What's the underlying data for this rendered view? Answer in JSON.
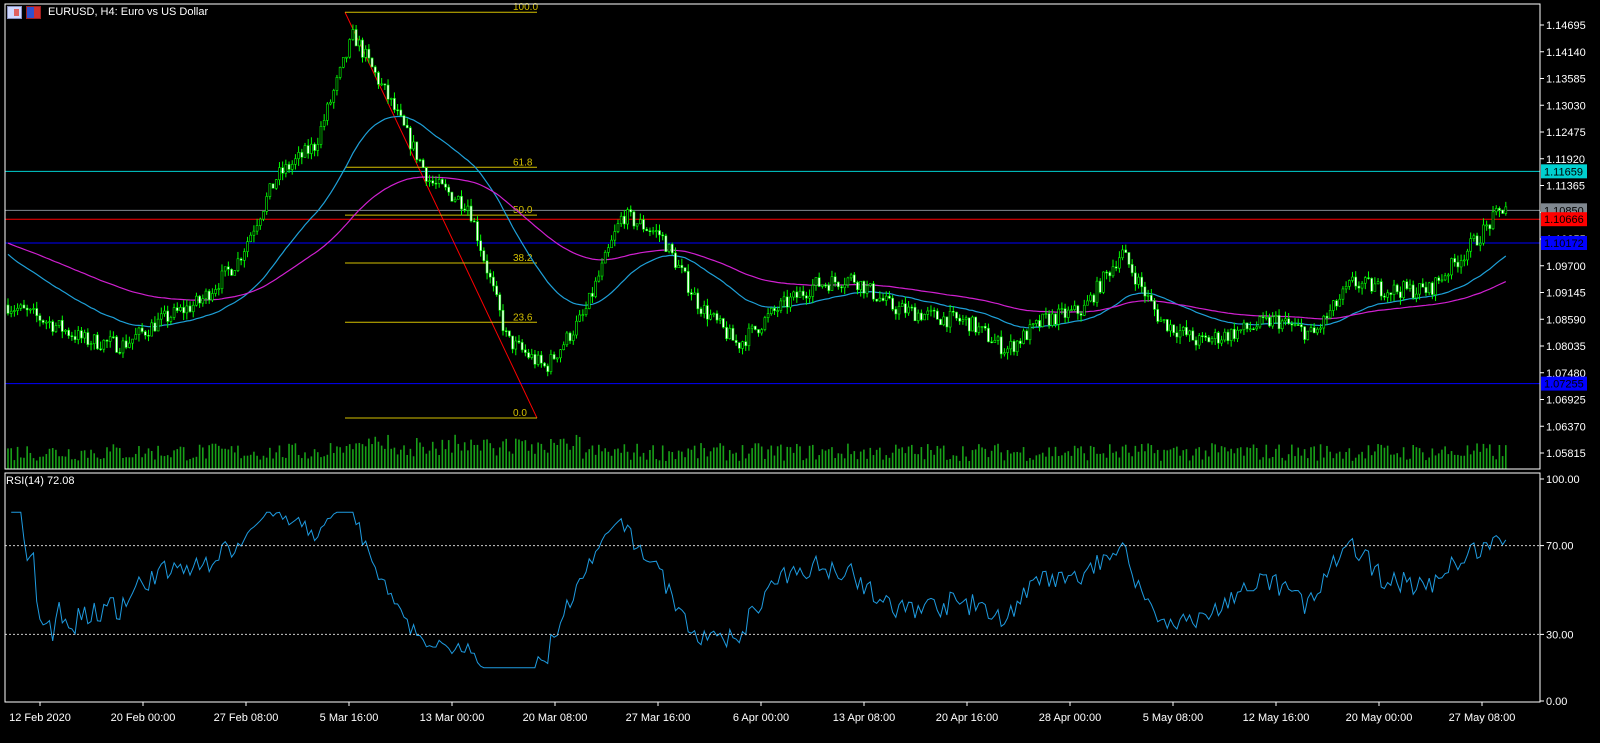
{
  "header": {
    "title": "EURUSD, H4:  Euro vs US Dollar",
    "icons": [
      "chart-window-icon",
      "save-icon"
    ]
  },
  "price_axis": {
    "ticks": [
      "1.14695",
      "1.14140",
      "1.13585",
      "1.13030",
      "1.12475",
      "1.11920",
      "1.11365",
      "1.10810",
      "1.10255",
      "1.09700",
      "1.09145",
      "1.08590",
      "1.08035",
      "1.07480",
      "1.06925",
      "1.06370",
      "1.05815"
    ]
  },
  "price_lines": [
    {
      "price": 1.11659,
      "label": "1.11659",
      "color": "#00d0d0",
      "text_color": "#000000"
    },
    {
      "price": 1.1085,
      "label": "1.10850",
      "color": "#808890",
      "text_color": "#000000"
    },
    {
      "price": 1.10666,
      "label": "1.10666",
      "color": "#ff0000",
      "text_color": "#000000"
    },
    {
      "price": 1.10172,
      "label": "1.10172",
      "color": "#0000ff",
      "text_color": "#000000"
    },
    {
      "price": 1.07255,
      "label": "1.07255",
      "color": "#0000ff",
      "text_color": "#000000"
    }
  ],
  "fibonacci": {
    "high": 1.1496,
    "low": 1.0654,
    "color": "#d4c000",
    "trend_color": "#ff0000",
    "levels": [
      {
        "value": 100.0,
        "label": "100.0"
      },
      {
        "value": 61.8,
        "label": "61.8"
      },
      {
        "value": 50.0,
        "label": "50.0"
      },
      {
        "value": 38.2,
        "label": "38.2"
      },
      {
        "value": 23.6,
        "label": "23.6"
      },
      {
        "value": 0.0,
        "label": "0.0"
      }
    ]
  },
  "time_axis": {
    "ticks": [
      "12 Feb 2020",
      "20 Feb 00:00",
      "27 Feb 08:00",
      "5 Mar 16:00",
      "13 Mar 00:00",
      "20 Mar 08:00",
      "27 Mar 16:00",
      "6 Apr 00:00",
      "13 Apr 08:00",
      "20 Apr 16:00",
      "28 Apr 00:00",
      "5 May 08:00",
      "12 May 16:00",
      "20 May 00:00",
      "27 May 08:00"
    ]
  },
  "rsi": {
    "title": "RSI(14) 72.08",
    "ticks": [
      "100.00",
      "70.00",
      "30.00",
      "0.00"
    ],
    "levels": [
      70,
      30
    ],
    "color": "#1e9be0"
  },
  "colors": {
    "candle": "#00ff00",
    "volume": "#18a018",
    "ma_fast": "#1ea0d8",
    "ma_slow": "#d020d0",
    "grid": "#ffffff"
  },
  "chart_data": {
    "type": "line",
    "symbol": "EURUSD",
    "timeframe": "H4",
    "ylim": [
      1.0555,
      1.151
    ],
    "x_ticks": [
      "12 Feb 2020",
      "20 Feb 00:00",
      "27 Feb 08:00",
      "5 Mar 16:00",
      "13 Mar 00:00",
      "20 Mar 08:00",
      "27 Mar 16:00",
      "6 Apr 00:00",
      "13 Apr 08:00",
      "20 Apr 16:00",
      "28 Apr 00:00",
      "5 May 08:00",
      "12 May 16:00",
      "20 May 00:00",
      "27 May 08:00"
    ],
    "close_path_approx": [
      1.08886,
      1.08554,
      1.08159,
      1.08056,
      1.08574,
      1.08948,
      1.09819,
      1.11541,
      1.12205,
      1.14488,
      1.13035,
      1.11438,
      1.1096,
      1.08159,
      1.07578,
      1.08678,
      1.10753,
      1.10338,
      1.08886,
      1.08056,
      1.08782,
      1.09301,
      1.09446,
      1.08844,
      1.08657,
      1.08533,
      1.07952,
      1.08574,
      1.08782,
      1.09985,
      1.08574,
      1.08118,
      1.08325,
      1.08574,
      1.08263,
      1.09342,
      1.09197,
      1.09197,
      1.10027,
      1.1096
    ],
    "last_price": 1.1085,
    "rsi_last": 72.08
  }
}
